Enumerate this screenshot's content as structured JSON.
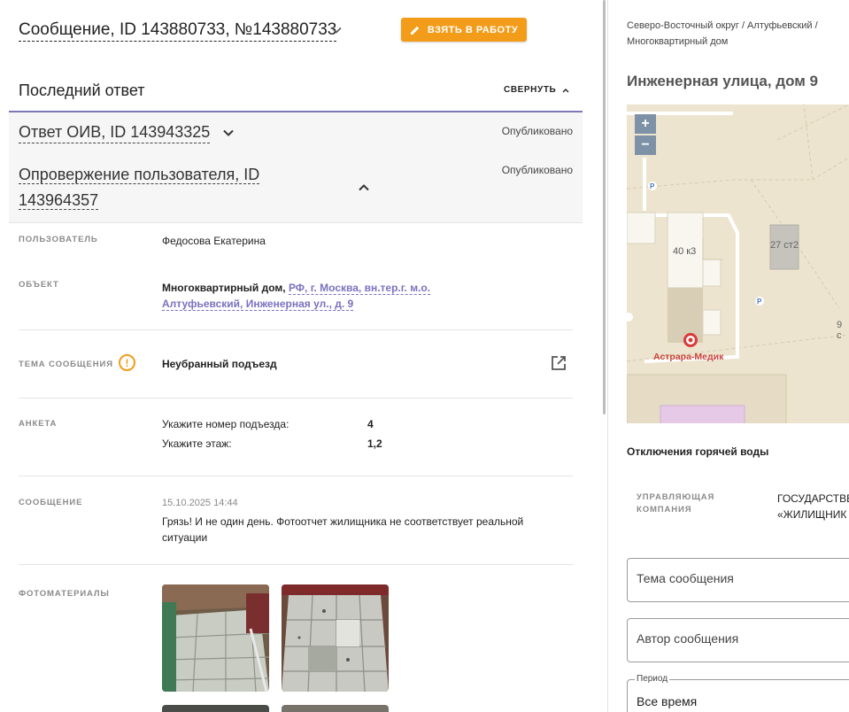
{
  "header": {
    "title": "Сообщение, ID 143880733, №143880733",
    "take_button": "ВЗЯТЬ В РАБОТУ"
  },
  "last_answer": {
    "title": "Последний ответ",
    "collapse": "СВЕРНУТЬ"
  },
  "answers": [
    {
      "title": "Ответ ОИВ, ID 143943325",
      "status": "Опубликовано"
    },
    {
      "title_line1": "Опровержение пользователя, ID",
      "title_line2": "143964357",
      "status": "Опубликовано"
    }
  ],
  "details": {
    "user_label": "ПОЛЬЗОВАТЕЛЬ",
    "user_value": "Федосова Екатерина",
    "object_label": "ОБЪЕКТ",
    "object_type": "Многоквартирный дом,",
    "object_link_line1": "РФ, г. Москва, вн.тер.г. м.о.",
    "object_link_line2": "Алтуфьевский, Инженерная ул., д. 9",
    "topic_label": "ТЕМА СООБЩЕНИЯ",
    "topic_warn": "!",
    "topic_value": "Неубранный подъезд",
    "survey_label": "АНКЕТА",
    "survey": [
      {
        "q": "Укажите номер подъезда:",
        "a": "4"
      },
      {
        "q": "Укажите этаж:",
        "a": "1,2"
      }
    ],
    "message_label": "СООБЩЕНИЕ",
    "message_date": "15.10.2025 14:44",
    "message_line1": "Грязь! И не один день. Фотоотчет жилищника не соответствует реальной",
    "message_line2": "ситуации",
    "photos_label": "ФОТОМАТЕРИАЛЫ"
  },
  "right": {
    "crumb_line1": "Северо-Восточный округ / Алтуфьевский /",
    "crumb_line2": "Многоквартирный дом",
    "address": "Инженерная улица, дом 9",
    "map": {
      "zoom_in": "+",
      "zoom_out": "−",
      "bld1": "40 к3",
      "bld2": "27 ст2",
      "bld3": "9 с",
      "poi": "Астрара-Медик",
      "parking": "P"
    },
    "hot_water": "Отключения горячей воды",
    "uk_label_line1": "УПРАВЛЯЮЩАЯ",
    "uk_label_line2": "КОМПАНИЯ",
    "uk_value_line1": "ГОСУДАРСТВЕ",
    "uk_value_line2": "«ЖИЛИЩНИК",
    "topic_placeholder": "Тема сообщения",
    "author_placeholder": "Автор сообщения",
    "period_legend": "Период",
    "period_value": "Все время"
  },
  "colors": {
    "accent_orange": "#f39c19",
    "link_purple": "#7a72c0",
    "answer_border": "#7e78b4"
  }
}
